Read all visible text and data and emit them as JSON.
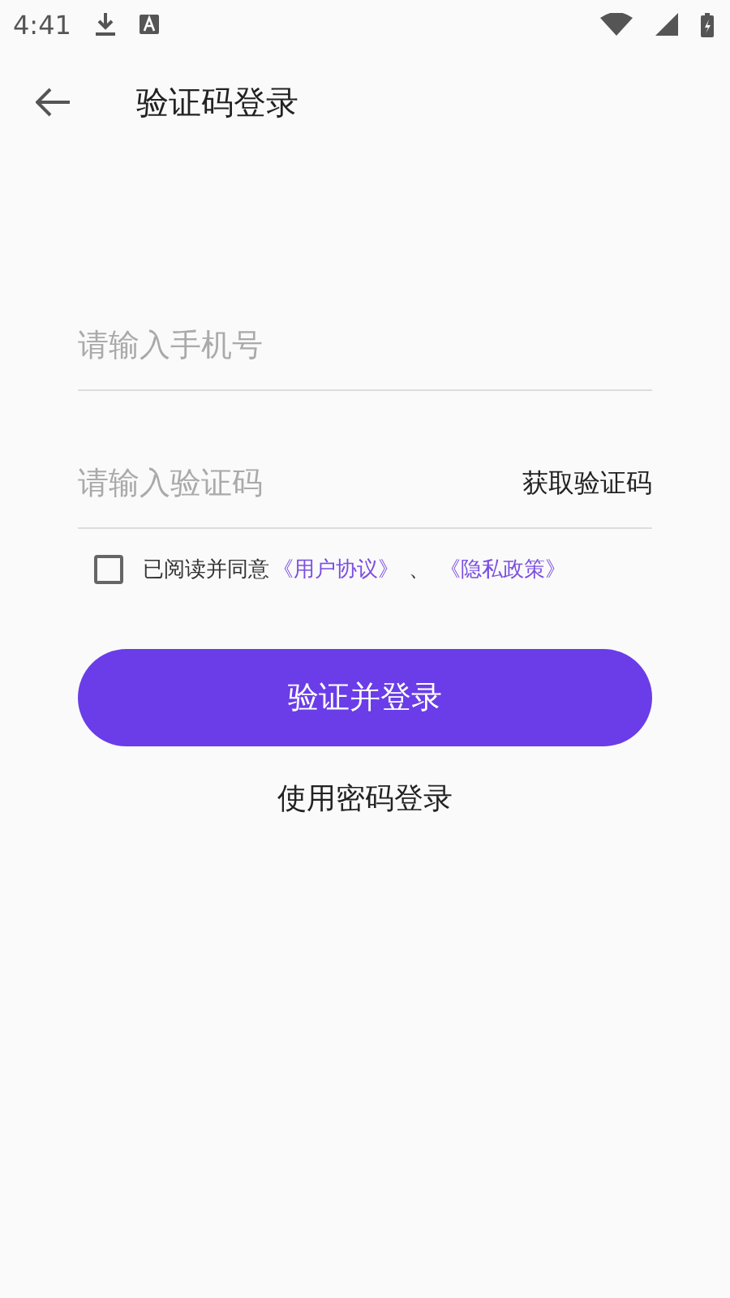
{
  "status_bar": {
    "time": "4:41"
  },
  "header": {
    "title": "验证码登录"
  },
  "phone_field": {
    "placeholder": "请输入手机号"
  },
  "code_field": {
    "placeholder": "请输入验证码",
    "action": "获取验证码"
  },
  "agreement": {
    "checked": false,
    "prefix": "已阅读并同意",
    "links": [
      "《用户协议》",
      "《隐私政策》"
    ],
    "separator": "、"
  },
  "submit_button": "验证并登录",
  "alt_login": "使用密码登录"
}
